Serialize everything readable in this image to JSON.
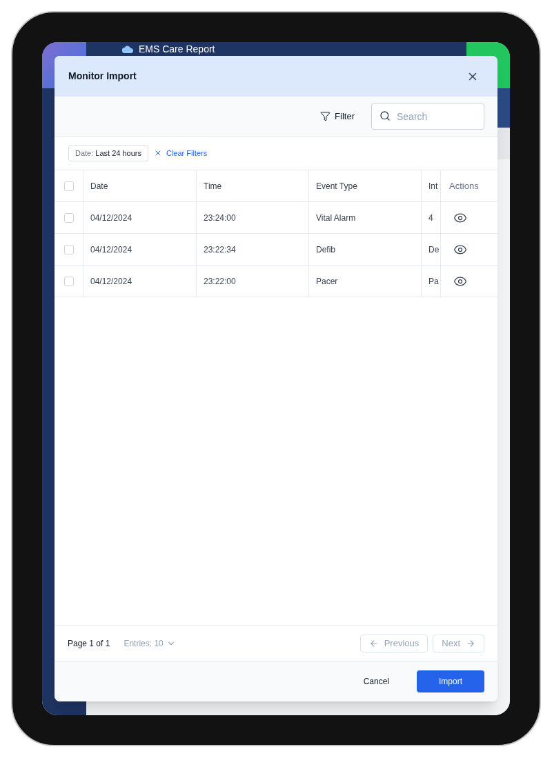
{
  "app": {
    "title": "EMS Care Report"
  },
  "modal": {
    "title": "Monitor Import",
    "toolbar": {
      "filter_label": "Filter",
      "search": {
        "placeholder": "Search"
      }
    },
    "active_filters": [
      {
        "key": "Date:",
        "value": "Last 24 hours"
      }
    ],
    "clear_filters": "Clear Filters",
    "table": {
      "select_all": {
        "checked": false
      },
      "columns": [
        "Date",
        "Time",
        "Event Type",
        "Int",
        "Actions"
      ],
      "rows": [
        {
          "checked": false,
          "cells": [
            "04/12/2024",
            "23:24:00",
            "Vital Alarm",
            "4"
          ]
        },
        {
          "checked": false,
          "cells": [
            "04/12/2024",
            "23:22:34",
            "Defib",
            "De"
          ]
        },
        {
          "checked": false,
          "cells": [
            "04/12/2024",
            "23:22:00",
            "Pacer",
            "Pa"
          ]
        }
      ]
    },
    "pagination": {
      "page": "Page 1 of 1",
      "entries": "Entries: 10",
      "previous": {
        "label": "Previous",
        "disabled": true
      },
      "next": {
        "label": "Next",
        "disabled": true
      }
    },
    "buttons": {
      "cancel": "Cancel",
      "import": "Import"
    }
  }
}
